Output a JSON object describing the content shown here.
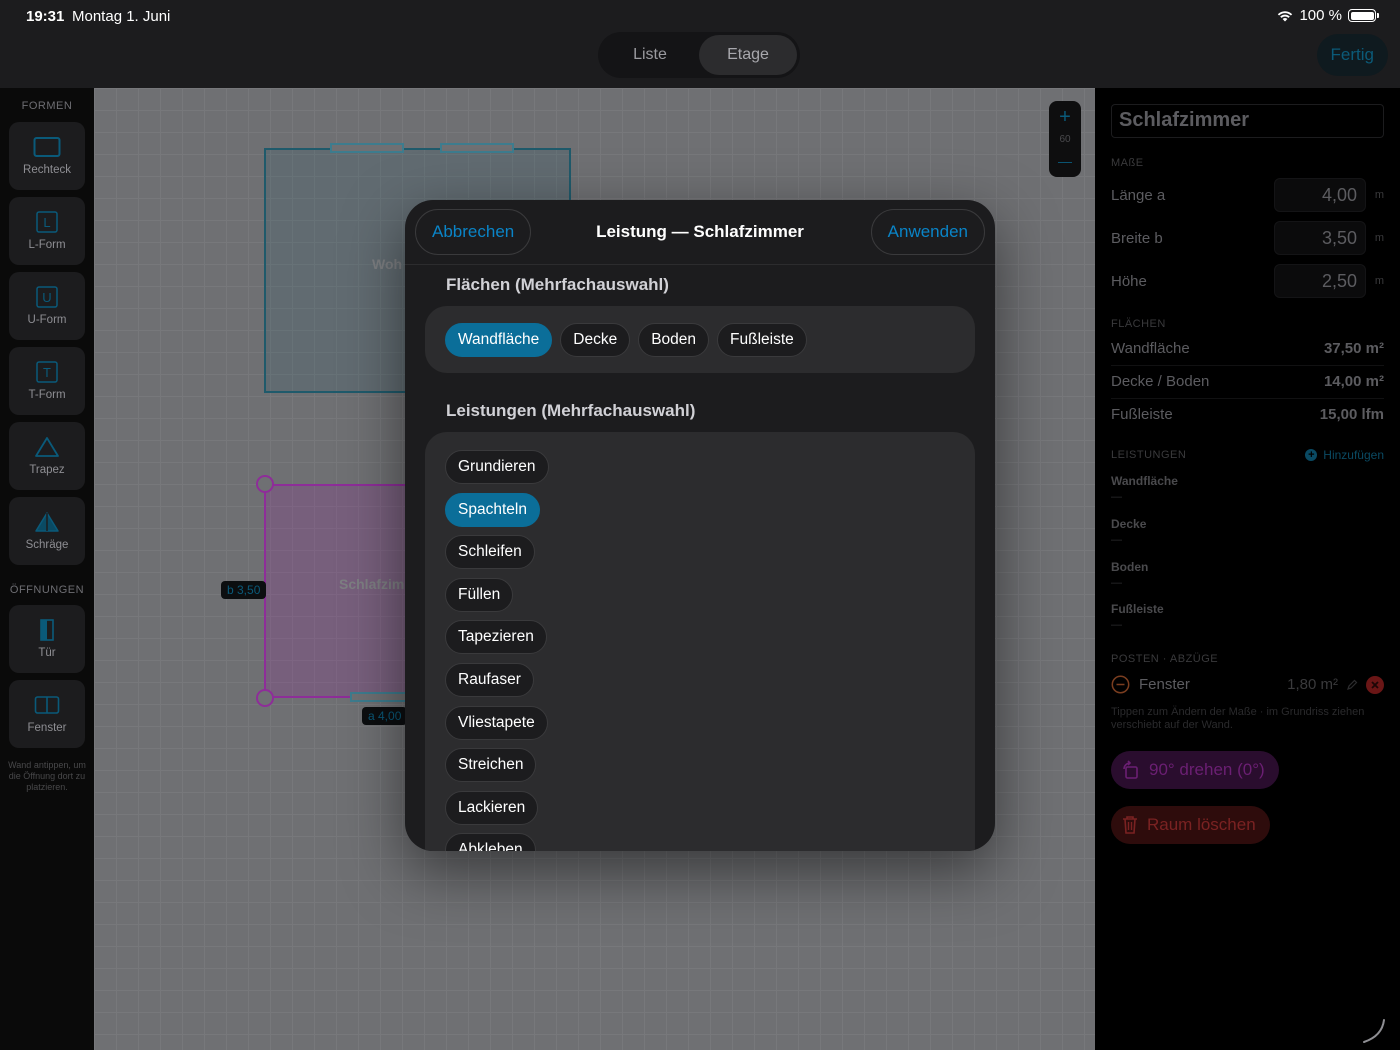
{
  "status": {
    "time": "19:31",
    "date": "Montag 1. Juni",
    "battery": "100 %"
  },
  "topbar": {
    "tabs": [
      {
        "label": "Liste",
        "active": false
      },
      {
        "label": "Etage",
        "active": true
      }
    ],
    "done_label": "Fertig"
  },
  "sidebar": {
    "shapes_title": "FORMEN",
    "shapes": [
      {
        "label": "Rechteck",
        "icon": "rectangle-icon"
      },
      {
        "label": "L-Form",
        "icon": "l-shape-icon"
      },
      {
        "label": "U-Form",
        "icon": "u-shape-icon"
      },
      {
        "label": "T-Form",
        "icon": "t-shape-icon"
      },
      {
        "label": "Trapez",
        "icon": "trapezoid-icon"
      },
      {
        "label": "Schräge",
        "icon": "slope-icon"
      }
    ],
    "openings_title": "ÖFFNUNGEN",
    "openings": [
      {
        "label": "Tür",
        "icon": "door-icon"
      },
      {
        "label": "Fenster",
        "icon": "window-icon"
      }
    ],
    "hint": "Wand antippen, um die Öffnung dort zu platzieren."
  },
  "canvas": {
    "rooms": [
      {
        "name": "Wohnzimmer",
        "visible_label": "Woh"
      },
      {
        "name": "Schlafzimmer",
        "visible_label": "Schlafzim"
      }
    ],
    "dim_b": "b 3,50",
    "dim_a": "a 4,00",
    "zoom_plus": "+",
    "zoom_value": "60",
    "zoom_minus": "—"
  },
  "inspector": {
    "room_title": "Schlafzimmer",
    "measures_title": "MAßE",
    "measures": [
      {
        "label": "Länge a",
        "value": "4,00",
        "unit": "m"
      },
      {
        "label": "Breite b",
        "value": "3,50",
        "unit": "m"
      },
      {
        "label": "Höhe",
        "value": "2,50",
        "unit": "m"
      }
    ],
    "areas_title": "FLÄCHEN",
    "areas": [
      {
        "label": "Wandfläche",
        "value": "37,50 m²"
      },
      {
        "label": "Decke / Boden",
        "value": "14,00 m²"
      },
      {
        "label": "Fußleiste",
        "value": "15,00 lfm"
      }
    ],
    "services_title": "LEISTUNGEN",
    "add_label": "Hinzufügen",
    "services": [
      {
        "label": "Wandfläche",
        "value": "—"
      },
      {
        "label": "Decke",
        "value": "—"
      },
      {
        "label": "Boden",
        "value": "—"
      },
      {
        "label": "Fußleiste",
        "value": "—"
      }
    ],
    "items_title": "POSTEN · ABZÜGE",
    "deduction": {
      "label": "Fenster",
      "value": "1,80 m²"
    },
    "hint": "Tippen zum Ändern der Maße · im Grundriss ziehen verschiebt auf der Wand.",
    "rotate_label": "90° drehen (0°)",
    "delete_label": "Raum löschen"
  },
  "modal": {
    "title": "Leistung — Schlafzimmer",
    "cancel_label": "Abbrechen",
    "apply_label": "Anwenden",
    "surfaces_title": "Flächen (Mehrfachauswahl)",
    "surfaces": [
      {
        "label": "Wandfläche",
        "selected": true
      },
      {
        "label": "Decke",
        "selected": false
      },
      {
        "label": "Boden",
        "selected": false
      },
      {
        "label": "Fußleiste",
        "selected": false
      }
    ],
    "services_title": "Leistungen (Mehrfachauswahl)",
    "services": [
      {
        "label": "Grundieren",
        "selected": false
      },
      {
        "label": "Spachteln",
        "selected": true
      },
      {
        "label": "Schleifen",
        "selected": false
      },
      {
        "label": "Füllen",
        "selected": false
      },
      {
        "label": "Tapezieren",
        "selected": false
      },
      {
        "label": "Raufaser",
        "selected": false
      },
      {
        "label": "Vliestapete",
        "selected": false
      },
      {
        "label": "Streichen",
        "selected": false
      },
      {
        "label": "Lackieren",
        "selected": false
      },
      {
        "label": "Abkleben",
        "selected": false
      }
    ]
  },
  "colors": {
    "accent": "#0b6e99",
    "room_purple": "#8e2d99",
    "room_teal": "#1f5a6b",
    "danger": "#7a2222"
  }
}
